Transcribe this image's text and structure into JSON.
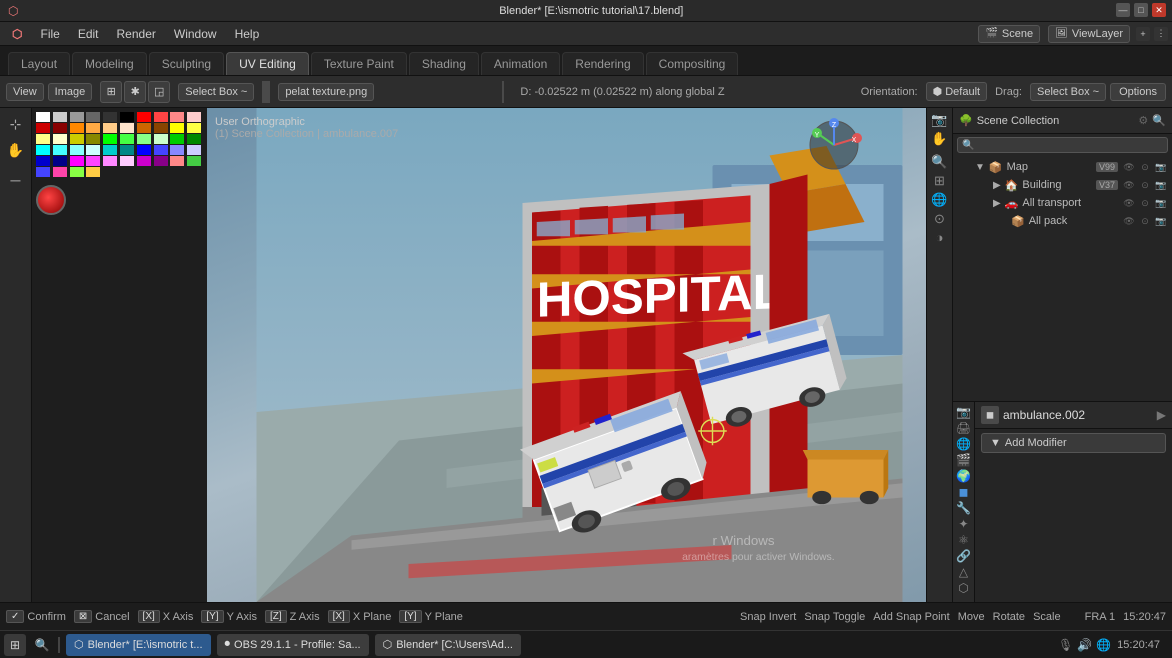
{
  "titlebar": {
    "title": "Blender* [E:\\ismotric tutorial\\17.blend]"
  },
  "menubar": {
    "items": [
      "Blender",
      "File",
      "Edit",
      "Render",
      "Window",
      "Help"
    ]
  },
  "workspace_tabs": {
    "tabs": [
      {
        "label": "Layout",
        "active": false
      },
      {
        "label": "Modeling",
        "active": false
      },
      {
        "label": "Sculpting",
        "active": false
      },
      {
        "label": "UV Editing",
        "active": true
      },
      {
        "label": "Texture Paint",
        "active": false
      },
      {
        "label": "Shading",
        "active": false
      },
      {
        "label": "Animation",
        "active": false
      },
      {
        "label": "Rendering",
        "active": false
      },
      {
        "label": "Compositing",
        "active": false
      }
    ]
  },
  "uv_header": {
    "view_label": "View",
    "image_label": "Image",
    "select_mode": "Select Box ~",
    "image_name": "pelat texture.png",
    "drag_label": "Drag:",
    "drag_value": "Select Box ~"
  },
  "viewport_header": {
    "orientation_label": "Orientation:",
    "orientation_value": "Default",
    "drag_label": "Drag:",
    "drag_value": "Select Box ~",
    "options_label": "Options",
    "status_text": "D: -0.02522 m (0.02522 m) along global Z"
  },
  "viewport": {
    "view_label": "User Orthographic",
    "collection_label": "(1) Scene Collection | ambulance.007"
  },
  "scene_panel": {
    "scene_name": "Scene",
    "view_layer_name": "ViewLayer",
    "tree_items": [
      {
        "name": "Map",
        "indent": 1,
        "badge": "V99",
        "icon": "📦"
      },
      {
        "name": "Building",
        "indent": 2,
        "badge": "V37",
        "icon": "🏠"
      },
      {
        "name": "All transport",
        "indent": 2,
        "badge": "",
        "icon": "🚗"
      },
      {
        "name": "All pack",
        "indent": 3,
        "badge": "",
        "icon": "📦"
      }
    ]
  },
  "properties_panel": {
    "object_name": "ambulance.002",
    "add_modifier_label": "Add Modifier"
  },
  "statusbar": {
    "confirm_key": "✓",
    "confirm_label": "Confirm",
    "cancel_key": "⊠",
    "cancel_label": "Cancel",
    "x_key": "[X]",
    "x_label": "X Axis",
    "y_key": "[Y]",
    "y_label": "Y Axis",
    "z_key": "[Z]",
    "z_label": "Z Axis",
    "x_plane_key": "[X]",
    "x_plane_label": "X Plane",
    "y_plane_key": "[Y]",
    "y_plane_label": "Y Plane",
    "snap_invert_label": "Snap Invert",
    "snap_toggle_label": "Snap Toggle",
    "add_snap_label": "Add Snap Point",
    "move_label": "Move",
    "rotate_label": "Rotate",
    "scale_label": "Scale",
    "obs_label": "OBS 29.1.1",
    "profile_label": "Profile: Sa...",
    "fra_label": "FRA 1",
    "time_label": "15:20:47"
  },
  "taskbar": {
    "apps": [
      "🎨"
    ],
    "items": [
      {
        "label": "Blender* [E:\\ismotric t...",
        "alt": false
      },
      {
        "label": "OBS 29.1.1 - Profile: Sa...",
        "alt": true
      },
      {
        "label": "Blender* [C:\\Users\\Ad...",
        "alt": true
      }
    ],
    "time": "15:20:47"
  },
  "colors": {
    "accent_blue": "#4a90d9",
    "bg_dark": "#1a1a1a",
    "bg_panel": "#252525",
    "bg_toolbar": "#2d2d2d",
    "tab_active": "#3a3a3a"
  },
  "color_swatches": [
    "#ffffff",
    "#cccccc",
    "#999999",
    "#666666",
    "#333333",
    "#000000",
    "#ff0000",
    "#ff4444",
    "#ff8888",
    "#ffcccc",
    "#cc0000",
    "#880000",
    "#ff8800",
    "#ffaa44",
    "#ffcc88",
    "#ffe4cc",
    "#cc6600",
    "#884400",
    "#ffff00",
    "#ffff44",
    "#ffff88",
    "#ffffcc",
    "#cccc00",
    "#888800",
    "#00ff00",
    "#44ff44",
    "#88ff88",
    "#ccffcc",
    "#00cc00",
    "#008800",
    "#00ffff",
    "#44ffff",
    "#88ffff",
    "#ccffff",
    "#00cccc",
    "#008888",
    "#0000ff",
    "#4444ff",
    "#8888ff",
    "#ccccff",
    "#0000cc",
    "#000088",
    "#ff00ff",
    "#ff44ff",
    "#ff88ff",
    "#ffccff",
    "#cc00cc",
    "#880088",
    "#ff8888",
    "#44cc44",
    "#4444ff",
    "#ff44aa",
    "#88ff44",
    "#ffcc44"
  ]
}
